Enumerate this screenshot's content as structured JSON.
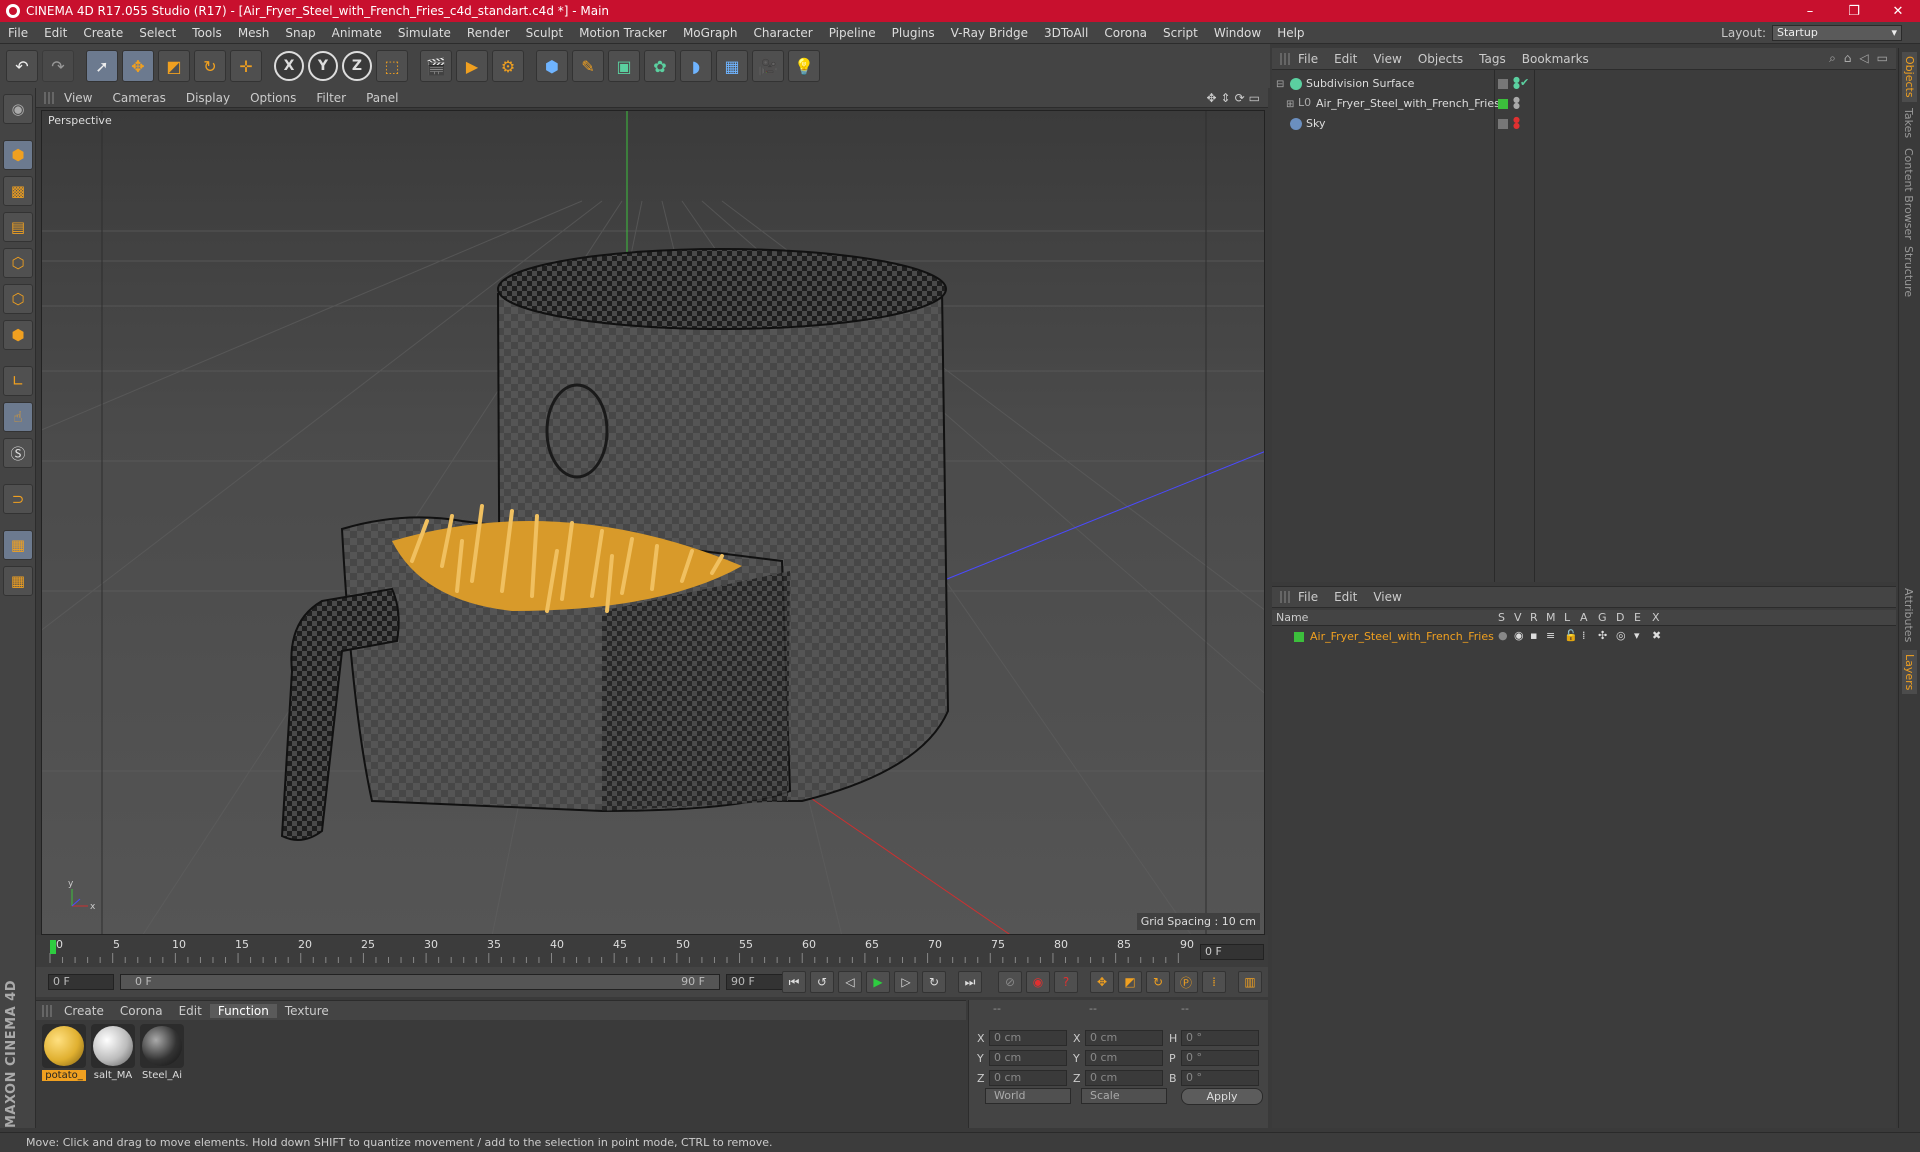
{
  "window": {
    "title": "CINEMA 4D R17.055 Studio (R17) - [Air_Fryer_Steel_with_French_Fries_c4d_standart.c4d *] - Main",
    "controls": [
      "–",
      "❐",
      "✕"
    ]
  },
  "menu": {
    "items": [
      "File",
      "Edit",
      "Create",
      "Select",
      "Tools",
      "Mesh",
      "Snap",
      "Animate",
      "Simulate",
      "Render",
      "Sculpt",
      "Motion Tracker",
      "MoGraph",
      "Character",
      "Pipeline",
      "Plugins",
      "V-Ray Bridge",
      "3DToAll",
      "Corona",
      "Script",
      "Window",
      "Help"
    ],
    "layout_label": "Layout:",
    "layout_value": "Startup"
  },
  "toolbar": {
    "axis_x": "X",
    "axis_y": "Y",
    "axis_z": "Z"
  },
  "viewport": {
    "menu": [
      "View",
      "Cameras",
      "Display",
      "Options",
      "Filter",
      "Panel"
    ],
    "label": "Perspective",
    "grid_spacing": "Grid Spacing : 10 cm"
  },
  "timeline": {
    "ticks": [
      "0",
      "5",
      "10",
      "15",
      "20",
      "25",
      "30",
      "35",
      "40",
      "45",
      "50",
      "55",
      "60",
      "65",
      "70",
      "75",
      "80",
      "85",
      "90"
    ],
    "current_frame": "0 F"
  },
  "playback": {
    "start_field": "0 F",
    "range_start": "0 F",
    "range_end": "90 F",
    "end_field": "90 F"
  },
  "materials": {
    "menu": [
      "Create",
      "Corona",
      "Edit",
      "Function",
      "Texture"
    ],
    "active_menu": "Function",
    "items": [
      {
        "name": "potato_",
        "color": "#e0b030",
        "selected": true
      },
      {
        "name": "salt_MA",
        "color": "#d0d0d0",
        "selected": false
      },
      {
        "name": "Steel_Ai",
        "color": "#3a3a3a",
        "selected": false
      }
    ]
  },
  "coords": {
    "headers": [
      "--",
      "--",
      "--"
    ],
    "rows": [
      {
        "a": "X",
        "v1": "0 cm",
        "b": "X",
        "v2": "0 cm",
        "c": "H",
        "v3": "0 °"
      },
      {
        "a": "Y",
        "v1": "0 cm",
        "b": "Y",
        "v2": "0 cm",
        "c": "P",
        "v3": "0 °"
      },
      {
        "a": "Z",
        "v1": "0 cm",
        "b": "Z",
        "v2": "0 cm",
        "c": "B",
        "v3": "0 °"
      }
    ],
    "space": "World",
    "mode": "Scale",
    "apply": "Apply"
  },
  "objects": {
    "menu": [
      "File",
      "Edit",
      "View",
      "Objects",
      "Tags",
      "Bookmarks"
    ],
    "rows": [
      {
        "name": "Subdivision Surface",
        "icon_color": "#5bd0a0",
        "indent": 0
      },
      {
        "name": "Air_Fryer_Steel_with_French_Fries",
        "icon_color": "#aaaaaa",
        "indent": 1
      },
      {
        "name": "Sky",
        "icon_color": "#6b8fbf",
        "indent": 0
      }
    ]
  },
  "layers": {
    "menu": [
      "File",
      "Edit",
      "View"
    ],
    "columns": [
      "Name",
      "S",
      "V",
      "R",
      "M",
      "L",
      "A",
      "G",
      "D",
      "E",
      "X"
    ],
    "row_name": "Air_Fryer_Steel_with_French_Fries",
    "row_color": "#f0a020"
  },
  "side_tabs": [
    "Objects",
    "Takes",
    "Content Browser",
    "Structure",
    "Attributes",
    "Layers"
  ],
  "status": "Move: Click and drag to move elements. Hold down SHIFT to quantize movement / add to the selection in point mode, CTRL to remove.",
  "brand": "MAXON CINEMA 4D"
}
